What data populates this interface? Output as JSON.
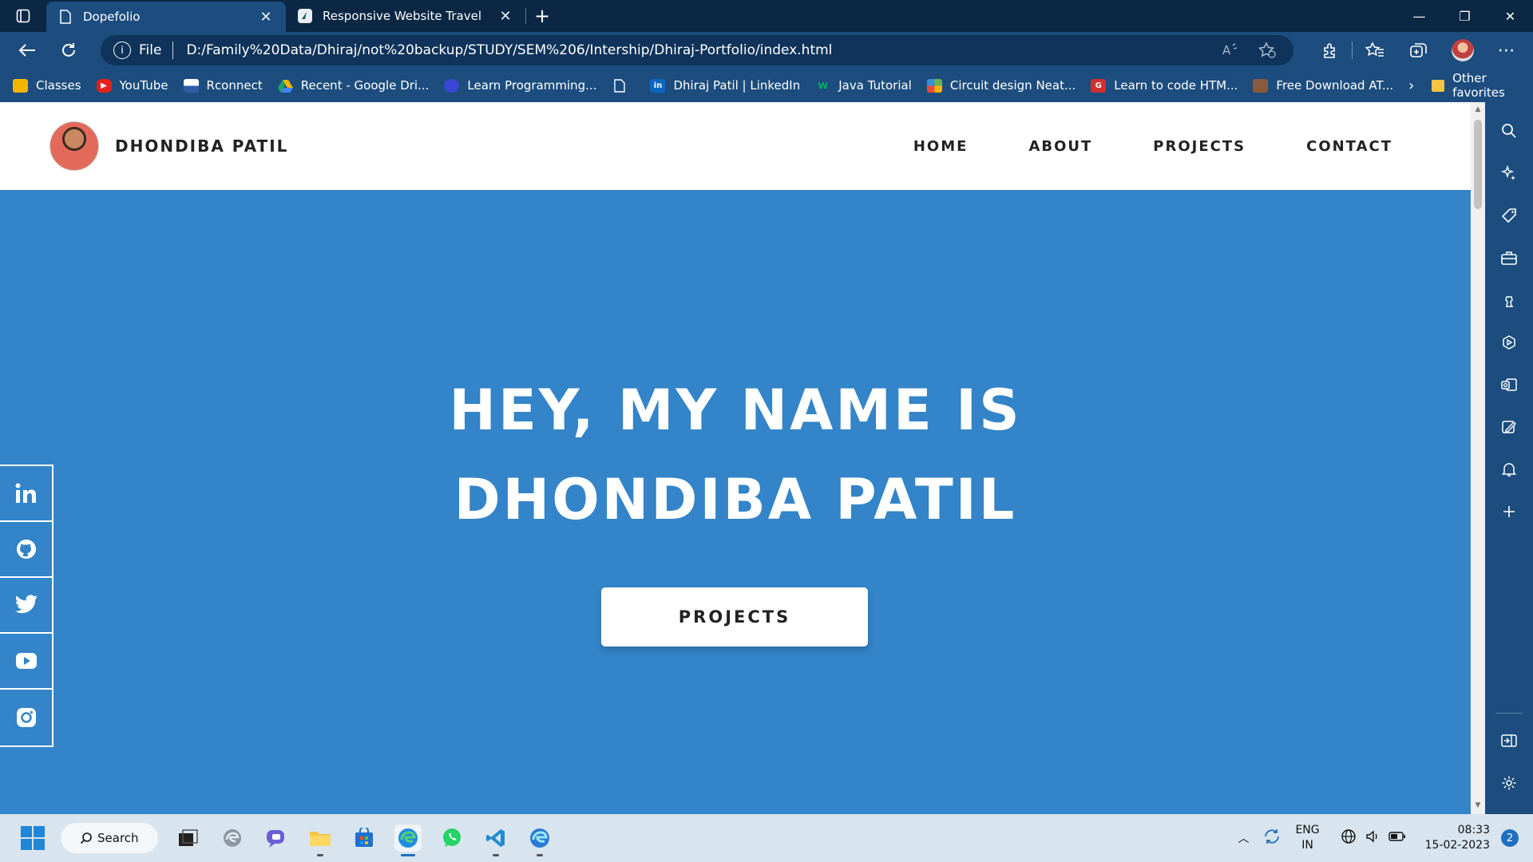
{
  "browser": {
    "tabs": [
      {
        "title": "Dopefolio",
        "active": true
      },
      {
        "title": "Responsive Website Travel",
        "active": false
      }
    ],
    "address": {
      "scheme_label": "File",
      "url": "D:/Family%20Data/Dhiraj/not%20backup/STUDY/SEM%206/Intership/Dhiraj-Portfolio/index.html"
    },
    "bookmarks": [
      {
        "label": "Classes",
        "icon": "classroom-icon",
        "color": "#f5b400"
      },
      {
        "label": "YouTube",
        "icon": "youtube-icon",
        "color": "#e62117"
      },
      {
        "label": "Rconnect",
        "icon": "rconnect-icon",
        "color": "#2c5fa8"
      },
      {
        "label": "Recent - Google Dri...",
        "icon": "google-drive-icon",
        "color": "#1fa463"
      },
      {
        "label": "Learn Programming...",
        "icon": "programming-icon",
        "color": "#3a47d5"
      },
      {
        "label": "",
        "icon": "page-icon",
        "color": "#ffffff"
      },
      {
        "label": "Dhiraj Patil | LinkedIn",
        "icon": "linkedin-icon",
        "color": "#0a66c2"
      },
      {
        "label": "Java Tutorial",
        "icon": "w3schools-icon",
        "color": "#04aa6d"
      },
      {
        "label": "Circuit design Neat...",
        "icon": "circuit-icon",
        "color": "#6bb34a"
      },
      {
        "label": "Learn to code HTM...",
        "icon": "codecademy-icon",
        "color": "#d32f2f"
      },
      {
        "label": "Free Download AT...",
        "icon": "download-icon",
        "color": "#8a5a3c"
      }
    ],
    "other_favorites": "Other favorites"
  },
  "site": {
    "logo_name": "DHONDIBA PATIL",
    "nav": [
      "HOME",
      "ABOUT",
      "PROJECTS",
      "CONTACT"
    ],
    "hero_title": "HEY, MY NAME IS DHONDIBA PATIL",
    "hero_button": "PROJECTS",
    "hero_color": "#3384c8",
    "social": [
      "linkedin-icon",
      "github-icon",
      "twitter-icon",
      "youtube-icon",
      "instagram-icon"
    ]
  },
  "taskbar": {
    "search_label": "Search",
    "lang_line1": "ENG",
    "lang_line2": "IN",
    "time": "08:33",
    "date": "15-02-2023",
    "notification_count": "2"
  }
}
